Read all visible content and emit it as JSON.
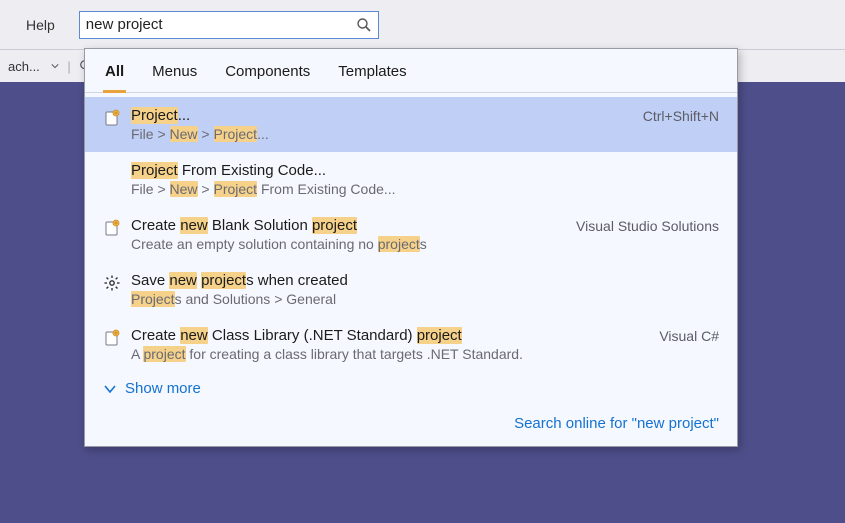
{
  "menu": {
    "help": "Help"
  },
  "search": {
    "value": "new project",
    "placeholder": ""
  },
  "toolbar_left": {
    "item": "ach..."
  },
  "tabs": [
    "All",
    "Menus",
    "Components",
    "Templates"
  ],
  "active_tab": 0,
  "results": [
    {
      "icon": "project-file-icon",
      "title_parts": [
        {
          "t": "Project",
          "hl": true
        },
        {
          "t": "...",
          "hl": false
        }
      ],
      "sub_parts": [
        {
          "t": "File > ",
          "hl": false
        },
        {
          "t": "New",
          "hl": true
        },
        {
          "t": " > ",
          "hl": false
        },
        {
          "t": "Project",
          "hl": true
        },
        {
          "t": "...",
          "hl": false
        }
      ],
      "right": "Ctrl+Shift+N",
      "selected": true
    },
    {
      "icon": "",
      "title_parts": [
        {
          "t": "Project",
          "hl": true
        },
        {
          "t": " From Existing Code...",
          "hl": false
        }
      ],
      "sub_parts": [
        {
          "t": "File > ",
          "hl": false
        },
        {
          "t": "New",
          "hl": true
        },
        {
          "t": " > ",
          "hl": false
        },
        {
          "t": "Project",
          "hl": true
        },
        {
          "t": " From Existing Code...",
          "hl": false
        }
      ],
      "right": "",
      "selected": false
    },
    {
      "icon": "project-file-icon",
      "title_parts": [
        {
          "t": "Create ",
          "hl": false
        },
        {
          "t": "new",
          "hl": true
        },
        {
          "t": " Blank Solution ",
          "hl": false
        },
        {
          "t": "project",
          "hl": true
        }
      ],
      "sub_parts": [
        {
          "t": "Create an empty solution containing no ",
          "hl": false
        },
        {
          "t": "project",
          "hl": true
        },
        {
          "t": "s",
          "hl": false
        }
      ],
      "right": "Visual Studio Solutions",
      "selected": false
    },
    {
      "icon": "gear-icon",
      "title_parts": [
        {
          "t": "Save ",
          "hl": false
        },
        {
          "t": "new",
          "hl": true
        },
        {
          "t": " ",
          "hl": false
        },
        {
          "t": "project",
          "hl": true
        },
        {
          "t": "s when created",
          "hl": false
        }
      ],
      "sub_parts": [
        {
          "t": "Project",
          "hl": true
        },
        {
          "t": "s and Solutions > General",
          "hl": false
        }
      ],
      "right": "",
      "selected": false
    },
    {
      "icon": "project-file-icon",
      "title_parts": [
        {
          "t": "Create ",
          "hl": false
        },
        {
          "t": "new",
          "hl": true
        },
        {
          "t": " Class Library (.NET Standard) ",
          "hl": false
        },
        {
          "t": "project",
          "hl": true
        }
      ],
      "sub_parts": [
        {
          "t": "A ",
          "hl": false
        },
        {
          "t": "project",
          "hl": true
        },
        {
          "t": " for creating a class library that targets .NET Standard.",
          "hl": false
        }
      ],
      "right": "Visual C#",
      "selected": false
    }
  ],
  "show_more": "Show more",
  "search_online": "Search online for \"new project\""
}
